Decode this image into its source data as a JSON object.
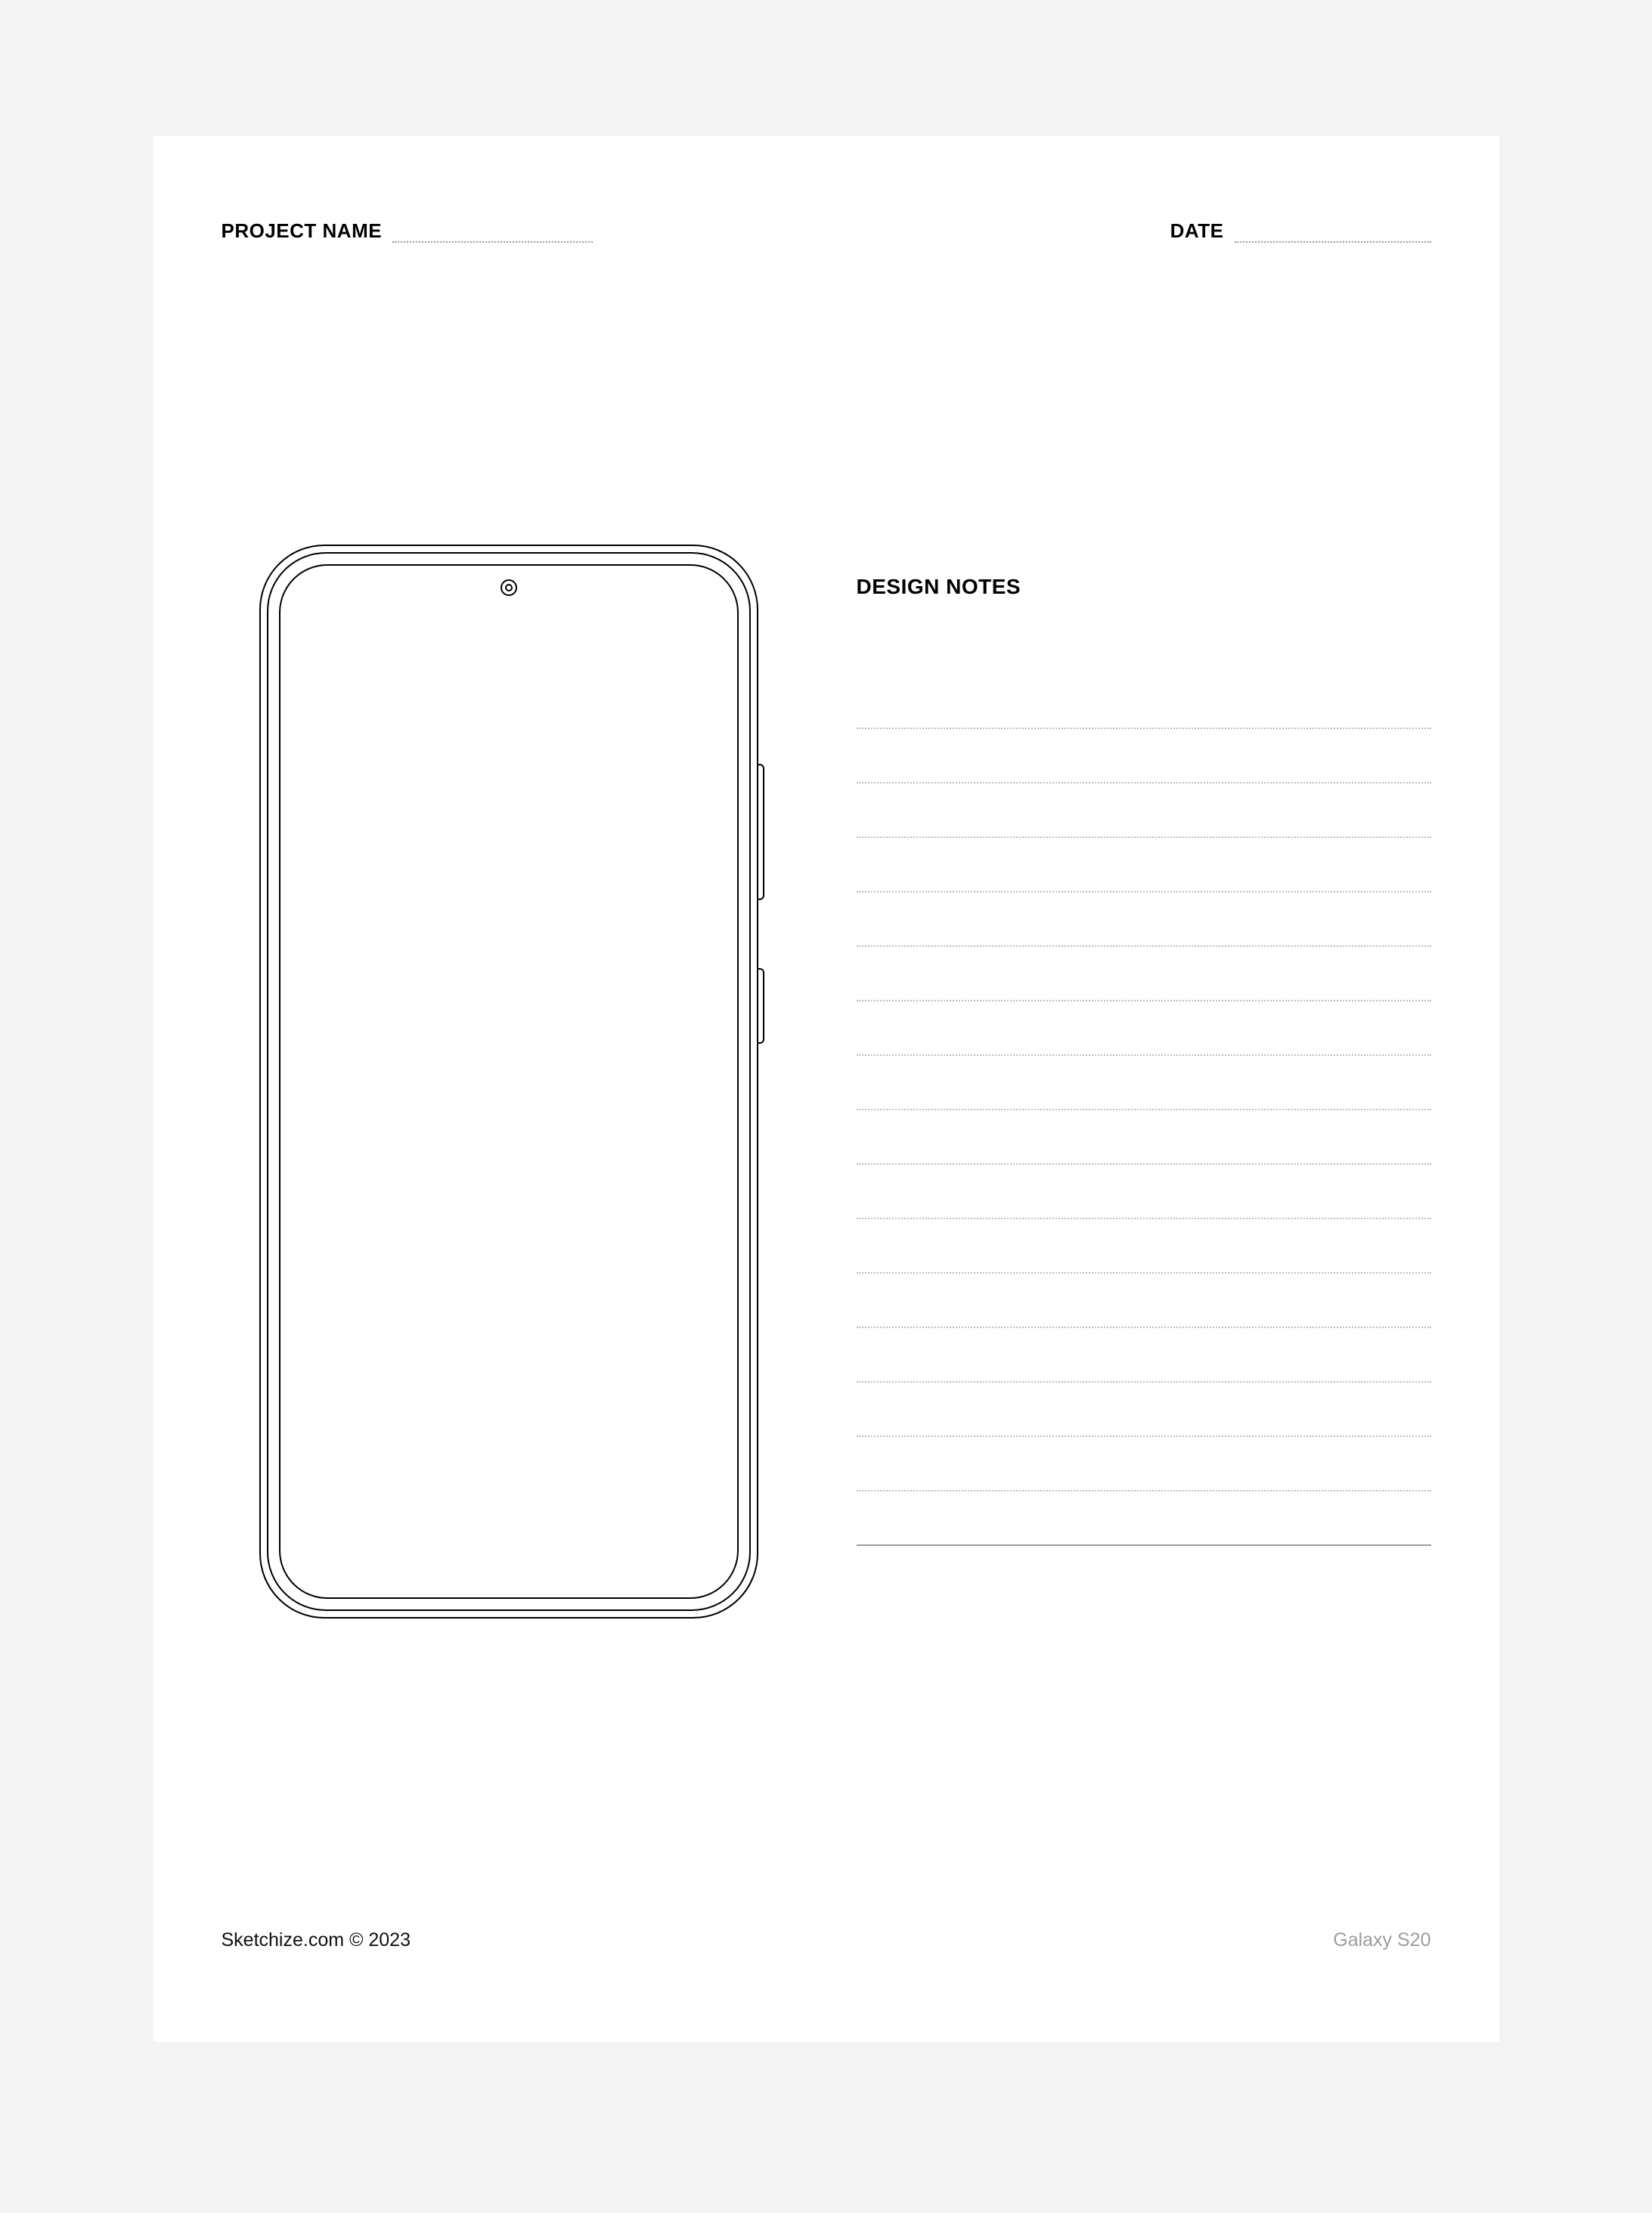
{
  "header": {
    "project_label": "PROJECT NAME",
    "date_label": "DATE"
  },
  "notes": {
    "title": "DESIGN NOTES",
    "line_count": 16
  },
  "footer": {
    "credit": "Sketchize.com © 2023",
    "device": "Galaxy S20"
  }
}
